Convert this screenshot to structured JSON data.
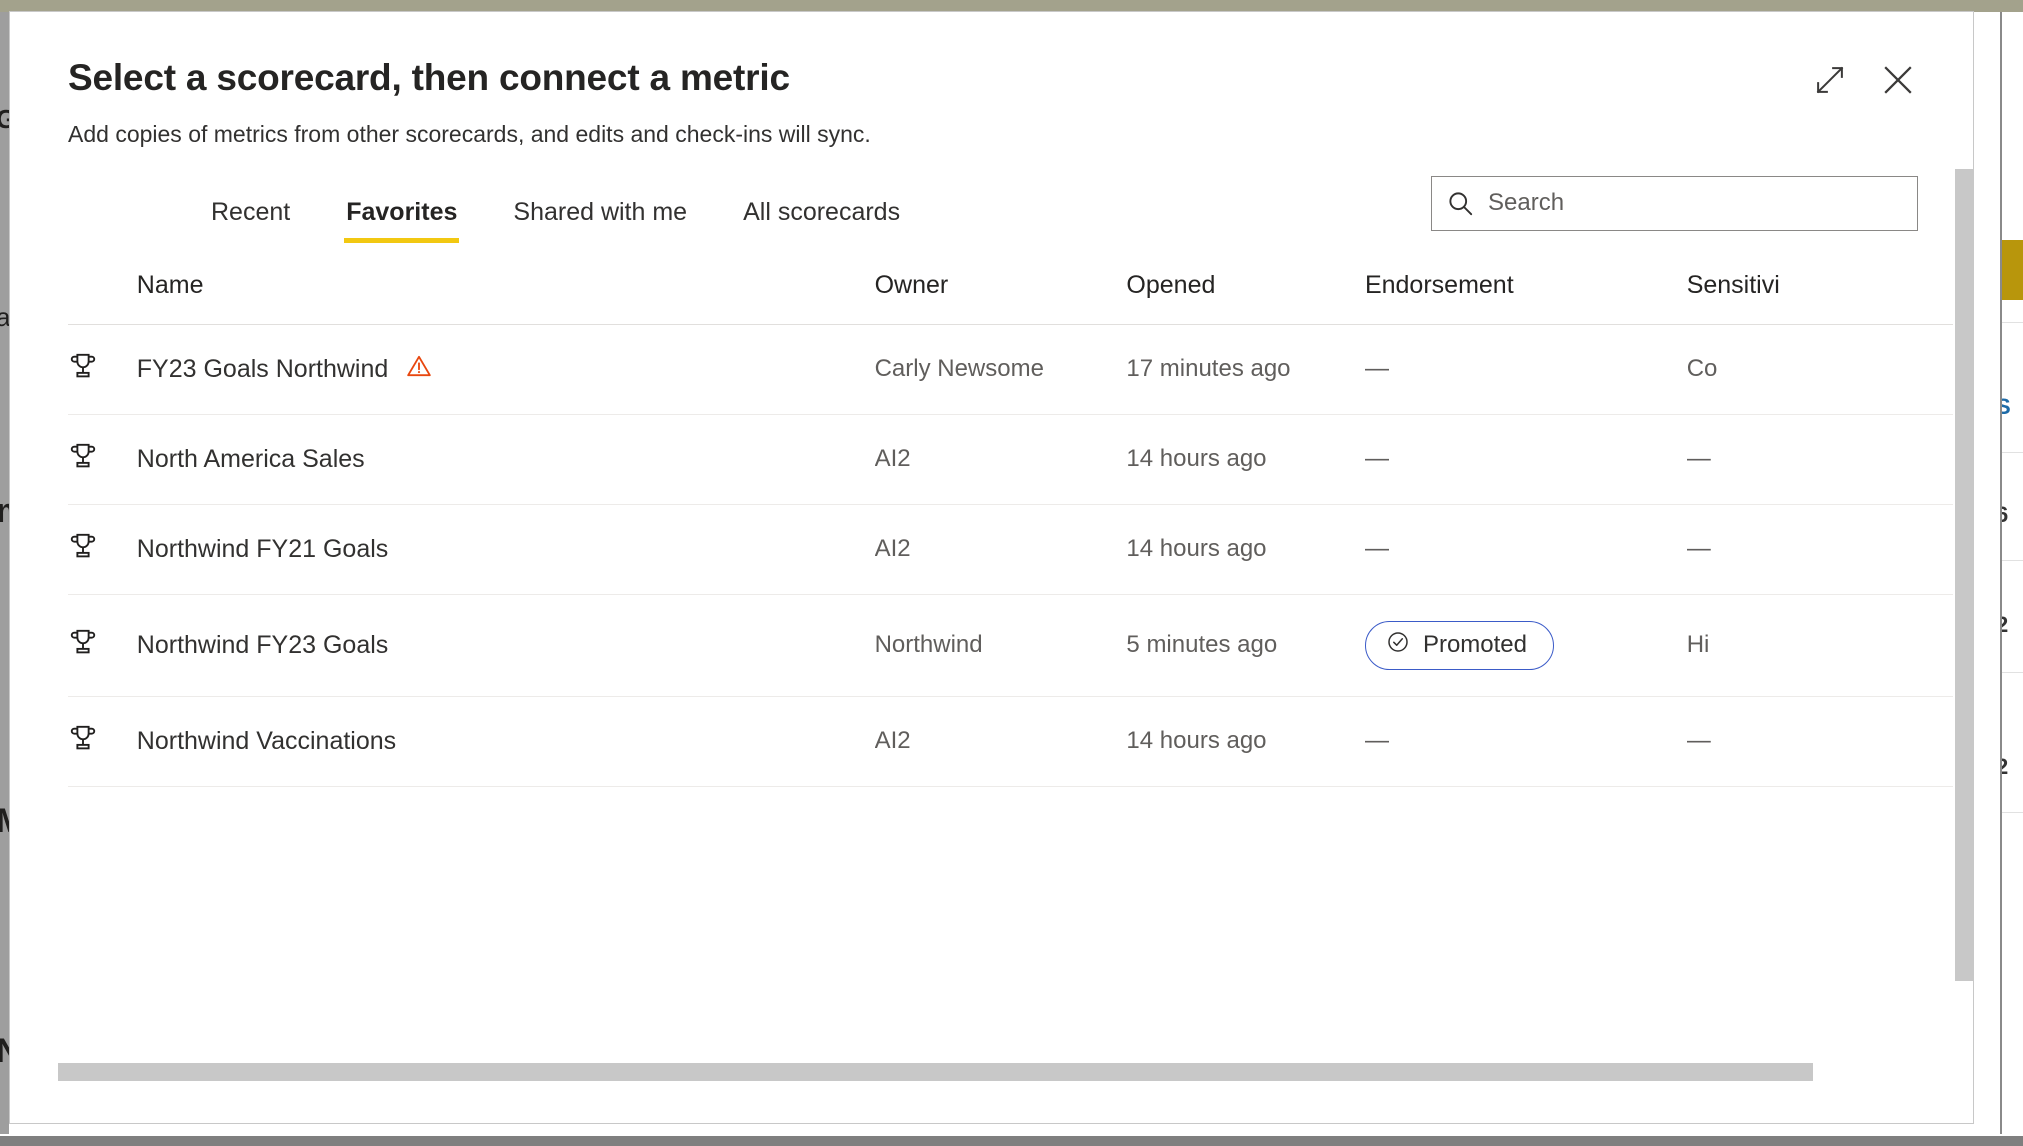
{
  "dialog": {
    "title": "Select a scorecard, then connect a metric",
    "subtitle": "Add copies of metrics from other scorecards, and edits and check-ins will sync.",
    "expand_label": "Expand",
    "close_label": "Close"
  },
  "tabs": [
    {
      "label": "Recent",
      "active": false
    },
    {
      "label": "Favorites",
      "active": true
    },
    {
      "label": "Shared with me",
      "active": false
    },
    {
      "label": "All scorecards",
      "active": false
    }
  ],
  "search": {
    "placeholder": "Search",
    "value": "",
    "icon": "search-icon"
  },
  "table": {
    "columns": [
      {
        "key": "icon",
        "label": ""
      },
      {
        "key": "name",
        "label": "Name"
      },
      {
        "key": "owner",
        "label": "Owner"
      },
      {
        "key": "opened",
        "label": "Opened"
      },
      {
        "key": "endorsement",
        "label": "Endorsement"
      },
      {
        "key": "sensitivity",
        "label": "Sensitivi"
      }
    ],
    "rows": [
      {
        "icon": "trophy-icon",
        "name": "FY23 Goals Northwind",
        "warning": true,
        "owner": "Carly Newsome",
        "opened": "17 minutes ago",
        "endorsement": "—",
        "endorsement_badge": null,
        "sensitivity": "Co"
      },
      {
        "icon": "trophy-icon",
        "name": "North America Sales",
        "warning": false,
        "owner": "AI2",
        "opened": "14 hours ago",
        "endorsement": "—",
        "endorsement_badge": null,
        "sensitivity": "—"
      },
      {
        "icon": "trophy-icon",
        "name": "Northwind FY21 Goals",
        "warning": false,
        "owner": "AI2",
        "opened": "14 hours ago",
        "endorsement": "—",
        "endorsement_badge": null,
        "sensitivity": "—"
      },
      {
        "icon": "trophy-icon",
        "name": "Northwind FY23 Goals",
        "warning": false,
        "owner": "Northwind",
        "opened": "5 minutes ago",
        "endorsement": "",
        "endorsement_badge": "Promoted",
        "sensitivity": "Hi"
      },
      {
        "icon": "trophy-icon",
        "name": "Northwind Vaccinations",
        "warning": false,
        "owner": "AI2",
        "opened": "14 hours ago",
        "endorsement": "—",
        "endorsement_badge": null,
        "sensitivity": "—"
      }
    ]
  },
  "colors": {
    "accent_tab_underline": "#f2c811",
    "warning": "#e8470f",
    "promoted_border": "#3b5bc8",
    "frame": "#a3a28c",
    "scrollbar": "#c8c8c8"
  },
  "background_fragments": {
    "left": [
      "G",
      "a",
      "m",
      "M",
      "N"
    ],
    "right": [
      "S",
      "6",
      "2",
      "2"
    ]
  }
}
